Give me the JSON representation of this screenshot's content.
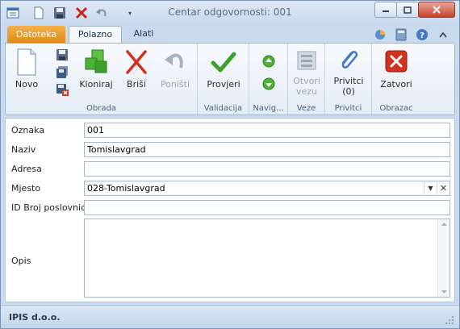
{
  "window": {
    "title": "Centar odgovornosti: 001"
  },
  "tabs": {
    "file": "Datoteka",
    "home": "Polazno",
    "tools": "Alati"
  },
  "ribbon": {
    "groups": {
      "edit": {
        "label": "Obrada",
        "new": "Novo",
        "clone": "Kloniraj",
        "delete": "Briši",
        "undo": "Poništi"
      },
      "validation": {
        "label": "Validacija",
        "check": "Provjeri"
      },
      "navigation": {
        "label": "Navig..."
      },
      "links": {
        "label": "Veze",
        "open_link_line1": "Otvori",
        "open_link_line2": "vezu"
      },
      "attachments": {
        "label": "Privitci",
        "attachments_line1": "Privitci",
        "attachments_line2": "(0)"
      },
      "form": {
        "label": "Obrazac",
        "close": "Zatvori"
      }
    }
  },
  "form": {
    "oznaka": {
      "label": "Oznaka",
      "value": "001"
    },
    "naziv": {
      "label": "Naziv",
      "value": "Tomislavgrad"
    },
    "adresa": {
      "label": "Adresa",
      "value": ""
    },
    "mjesto": {
      "label": "Mjesto",
      "value": "028-Tomislavgrad"
    },
    "id_broj": {
      "label": "ID Broj poslovnice",
      "value": ""
    },
    "opis": {
      "label": "Opis",
      "value": ""
    }
  },
  "status": {
    "company": "IPIS d.o.o."
  },
  "colors": {
    "file_tab": "#e08a14",
    "accent_green": "#3aa12b",
    "accent_red": "#d0321e"
  }
}
